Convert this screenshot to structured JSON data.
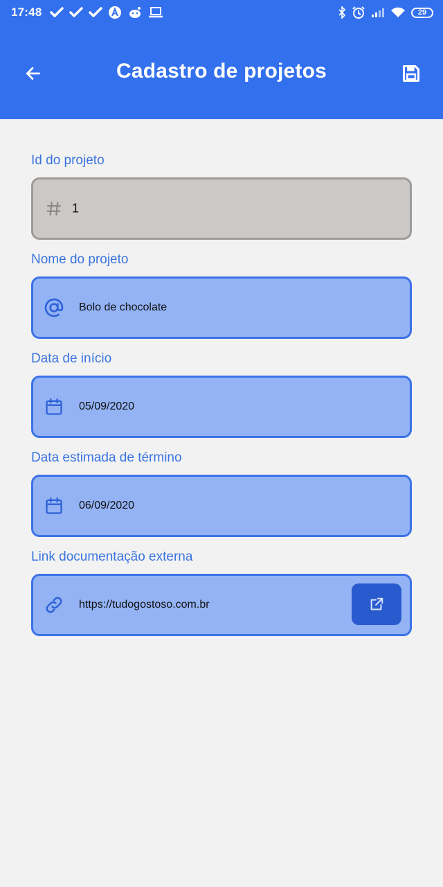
{
  "status_bar": {
    "time": "17:48",
    "battery": "29",
    "left_icons": [
      "check-icon",
      "check-icon",
      "check-icon",
      "app-a-icon",
      "reddit-icon",
      "laptop-icon"
    ],
    "right_icons": [
      "bluetooth-icon",
      "alarm-icon",
      "signal-icon",
      "wifi-icon",
      "battery-icon"
    ]
  },
  "header": {
    "title": "Cadastro de projetos",
    "back_icon": "arrow-left-icon",
    "save_icon": "floppy-save-icon",
    "color": "#3370ee"
  },
  "form": {
    "id_label": "Id do projeto",
    "id_value": "1",
    "name_label": "Nome do projeto",
    "name_value": "Bolo de chocolate",
    "start_label": "Data de início",
    "start_value": "05/09/2020",
    "end_label": "Data estimada de término",
    "end_value": "06/09/2020",
    "link_label": "Link documentação externa",
    "link_value": "https://tudogostoso.com.br"
  },
  "colors": {
    "accent": "#3370ee",
    "field_fill": "#93b3f5",
    "field_border": "#3c72e8",
    "disabled_fill": "#cbc9c7",
    "label": "#3a74e0",
    "button": "#2a5bce"
  }
}
